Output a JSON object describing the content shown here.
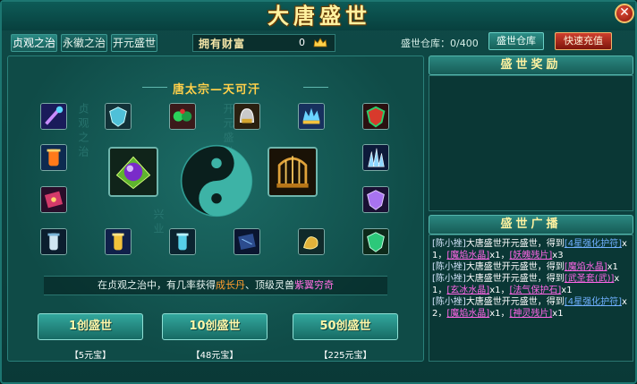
{
  "window": {
    "title": "大唐盛世",
    "close_symbol": "✕"
  },
  "tabs": [
    {
      "label": "贞观之治",
      "active": true
    },
    {
      "label": "永徽之治",
      "active": false
    },
    {
      "label": "开元盛世",
      "active": false
    }
  ],
  "wealth": {
    "label": "拥有财富",
    "value": "0"
  },
  "storage": {
    "count_text": "盛世仓库：0/400",
    "button_label": "盛世仓库"
  },
  "recharge_label": "快速充值",
  "ruler_title": "唐太宗—天可汗",
  "watermarks": {
    "left": "贞观之治",
    "right": "开元盛世",
    "bottom": "兴业"
  },
  "info_text": {
    "prefix": "在贞观之治中，有几率获得",
    "item1": "成长丹",
    "sep": "、顶级灵兽",
    "item2": "紫翼穷奇"
  },
  "draw_buttons": [
    {
      "label": "1创盛世",
      "price": "【5元宝】"
    },
    {
      "label": "10创盛世",
      "price": "【48元宝】"
    },
    {
      "label": "50创盛世",
      "price": "【225元宝】"
    }
  ],
  "rewards_header": "盛世奖励",
  "broadcast_header": "盛世广播",
  "broadcast": [
    {
      "player": "[陈小挫]",
      "text": "大唐盛世开元盛世，得到",
      "items": [
        {
          "name": "[4星强化护符]",
          "qty": "x1",
          "color": "blue"
        },
        {
          "name": "[魔焰水晶]",
          "qty": "x1",
          "color": "pink"
        },
        {
          "name": "[妖魄残片]",
          "qty": "x3",
          "color": "pink"
        }
      ]
    },
    {
      "player": "[陈小挫]",
      "text": "大唐盛世开元盛世，得到",
      "items": [
        {
          "name": "[魔焰水晶]",
          "qty": "x1",
          "color": "pink"
        }
      ]
    },
    {
      "player": "[陈小挫]",
      "text": "大唐盛世开元盛世，得到",
      "items": [
        {
          "name": "[武圣套(武)]",
          "qty": "x1",
          "color": "pink"
        },
        {
          "name": "[玄冰水晶]",
          "qty": "x1",
          "color": "pink"
        },
        {
          "name": "[法气保护石]",
          "qty": "x1",
          "color": "pink"
        }
      ]
    },
    {
      "player": "[陈小挫]",
      "text": "大唐盛世开元盛世，得到",
      "items": [
        {
          "name": "[4星强化护符]",
          "qty": "x2",
          "color": "blue"
        },
        {
          "name": "[魔焰水晶]",
          "qty": "x1",
          "color": "pink"
        },
        {
          "name": "[神灵残片]",
          "qty": "x1",
          "color": "pink"
        }
      ]
    }
  ],
  "colors": {
    "panel": "#0f4a47",
    "accent_gold": "#ffd04a",
    "pink_item": "#ff66e8",
    "blue_item": "#6fb0ff",
    "recharge_red": "#d03f2e"
  },
  "item_icons": [
    "purple-staff-icon",
    "blue-shield-icon",
    "green-gems-icon",
    "silver-helmet-icon",
    "ice-crown-icon",
    "red-shield-icon",
    "fire-scroll-icon",
    "ice-crystal-icon",
    "red-book-icon",
    "purple-shield-icon",
    "ice-scroll-icon",
    "gold-scroll-icon",
    "blue-scroll-icon",
    "dark-book-icon",
    "gold-dragon-icon",
    "emerald-shield-icon"
  ],
  "feature_icons": [
    "purple-orb-icon",
    "golden-cage-icon"
  ]
}
